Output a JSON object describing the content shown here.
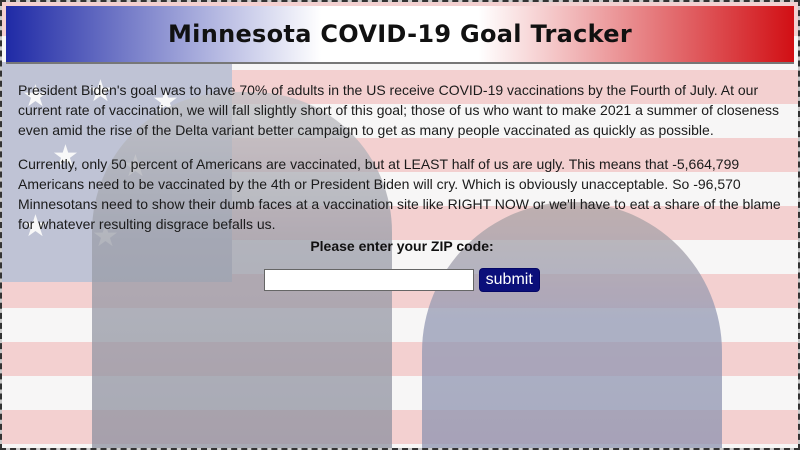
{
  "header": {
    "title": "Minnesota COVID-19 Goal Tracker"
  },
  "content": {
    "paragraph_1": "President Biden's goal was to have 70% of adults in the US receive COVID-19 vaccinations by the Fourth of July. At our current rate of vaccination, we will fall slightly short of this goal; those of us who want to make 2021 a summer of closeness even amid the rise of the Delta variant better campaign to get as many people vaccinated as quickly as possible.",
    "paragraph_2": "Currently, only 50 percent of Americans are vaccinated, but at LEAST half of us are ugly. This means that -5,664,799 Americans need to be vaccinated by the 4th or President Biden will cry. Which is obviously unacceptable. So -96,570 Minnesotans need to show their dumb faces at a vaccination site like RIGHT NOW or we'll have to eat a share of the blame for whatever resulting disgrace befalls us."
  },
  "zip_form": {
    "label": "Please enter your ZIP code:",
    "input_value": "",
    "submit_label": "submit"
  },
  "colors": {
    "header_left": "#1f2aa6",
    "header_right": "#d10f14",
    "submit_bg": "#0b0f7a"
  }
}
